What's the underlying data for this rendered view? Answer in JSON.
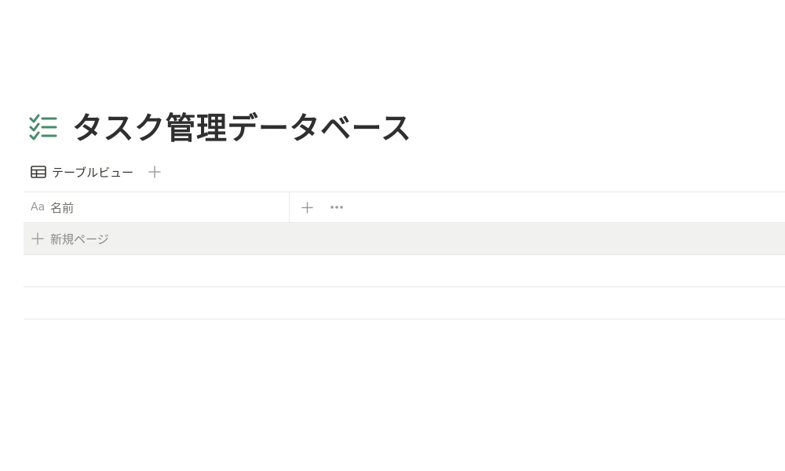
{
  "page": {
    "title": "タスク管理データベース",
    "icon": "checklist-icon",
    "icon_color": "#4a8a6a"
  },
  "views": {
    "tabs": [
      {
        "label": "テーブルビュー",
        "icon": "table-icon"
      }
    ],
    "add_view_icon": "plus-icon"
  },
  "table": {
    "columns": [
      {
        "label": "名前",
        "icon_text": "Aa"
      }
    ],
    "header_add_icon": "plus-icon",
    "header_more_icon": "more-icon",
    "new_page_label": "新規ページ"
  },
  "colors": {
    "text": "#37352f",
    "muted": "#9b9a97",
    "border": "#e9e9e7",
    "row_highlight": "#f1f1ef"
  }
}
